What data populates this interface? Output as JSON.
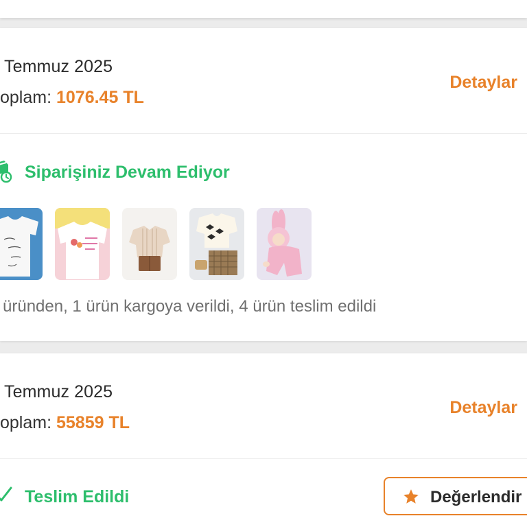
{
  "colors": {
    "accent": "#e8822a",
    "success": "#2dbe6c",
    "text": "#2b2b2b",
    "muted": "#6f6f6f"
  },
  "orders": [
    {
      "date": "Temmuz 2025",
      "total_label": "oplam:",
      "total_amount": "1076.45 TL",
      "details_label": "Detaylar",
      "status": "Siparişiniz Devam Ediyor",
      "status_icon": "delivery-truck-clock-icon",
      "products": [
        {
          "name": "onesie-handwriting-icon"
        },
        {
          "name": "onesie-pink-print-icon"
        },
        {
          "name": "boys-shirt-shorts-icon"
        },
        {
          "name": "bow-dress-set-icon"
        },
        {
          "name": "pink-bunny-suit-icon"
        }
      ],
      "summary": "üründen, 1 ürün kargoya verildi, 4 ürün teslim edildi"
    },
    {
      "date": "Temmuz 2025",
      "total_label": "oplam:",
      "total_amount": "55859 TL",
      "details_label": "Detaylar",
      "status": "Teslim Edildi",
      "status_icon": "checkmark-icon",
      "rate_label": "Değerlendir",
      "rate_icon": "star-icon"
    }
  ]
}
